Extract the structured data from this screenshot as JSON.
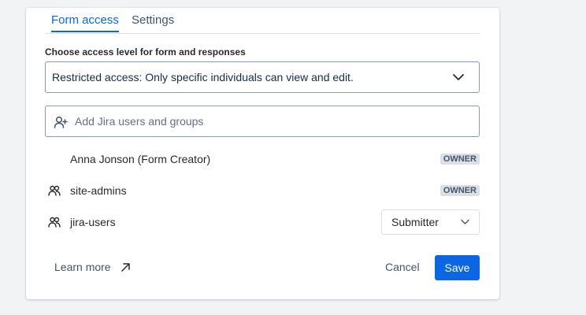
{
  "tabs": [
    {
      "label": "Form access",
      "active": true
    },
    {
      "label": "Settings",
      "active": false
    }
  ],
  "access": {
    "label": "Choose access level for form and responses",
    "selected": "Restricted access: Only specific individuals can view and edit."
  },
  "search": {
    "placeholder": "Add Jira users and groups",
    "value": ""
  },
  "members": [
    {
      "name": "Anna Jonson (Form Creator)",
      "icon": "none",
      "badge": "OWNER"
    },
    {
      "name": "site-admins",
      "icon": "people-group-icon",
      "badge": "OWNER"
    },
    {
      "name": "jira-users",
      "icon": "people-group-icon",
      "role": "Submitter"
    }
  ],
  "footer": {
    "learn_more": "Learn more",
    "cancel": "Cancel",
    "save": "Save"
  },
  "colors": {
    "accent": "#0c66e4",
    "text": "#292a2e",
    "muted": "#44546f",
    "badge_bg": "#dcdfe4"
  }
}
